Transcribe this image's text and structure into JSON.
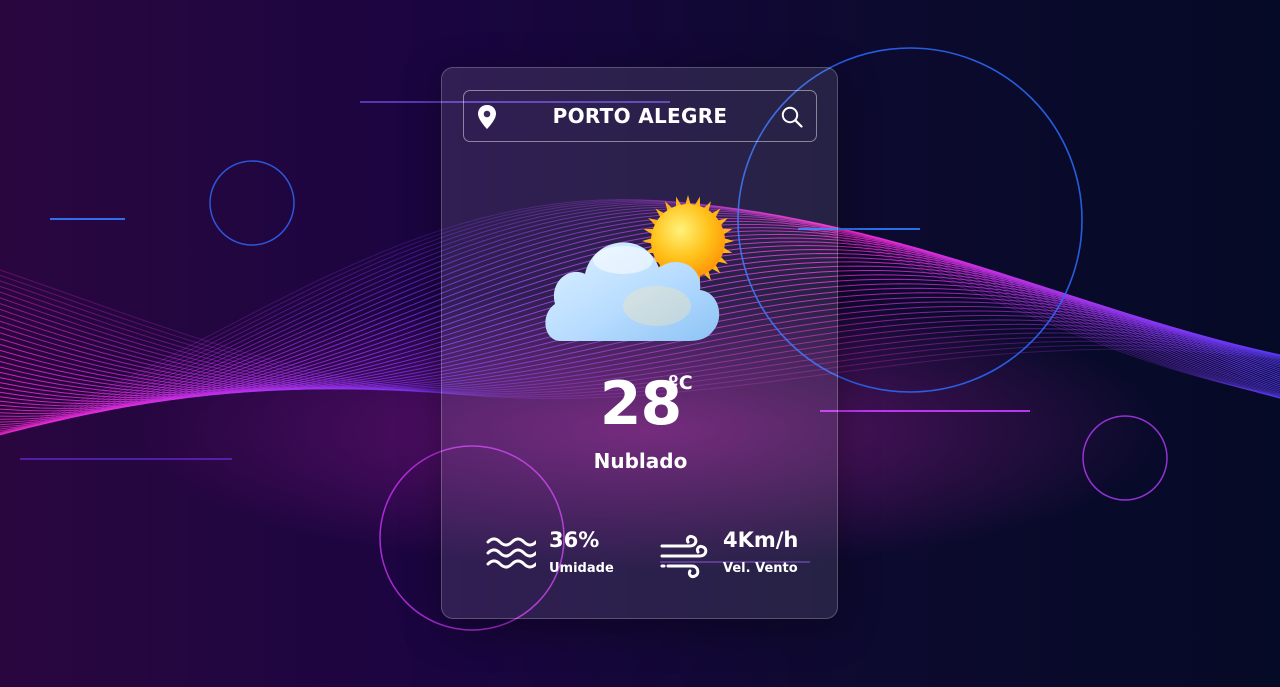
{
  "location": {
    "city": "PORTO ALEGRE",
    "pin_icon": "location-pin-icon",
    "search_icon": "search-icon"
  },
  "current": {
    "temperature": "28",
    "unit": "ºC",
    "condition": "Nublado",
    "condition_icon": "cloud-sun-icon"
  },
  "stats": {
    "humidity": {
      "value": "36%",
      "label": "Umidade",
      "icon": "water-waves-icon"
    },
    "wind": {
      "value": "4Km/h",
      "label": "Vel. Vento",
      "icon": "wind-icon"
    }
  },
  "colors": {
    "accent_magenta": "#ff2bd6",
    "accent_violet": "#7a35ff",
    "accent_blue": "#2d6bff",
    "sun": "#ffb21a",
    "cloud": "#bfe3ff"
  }
}
